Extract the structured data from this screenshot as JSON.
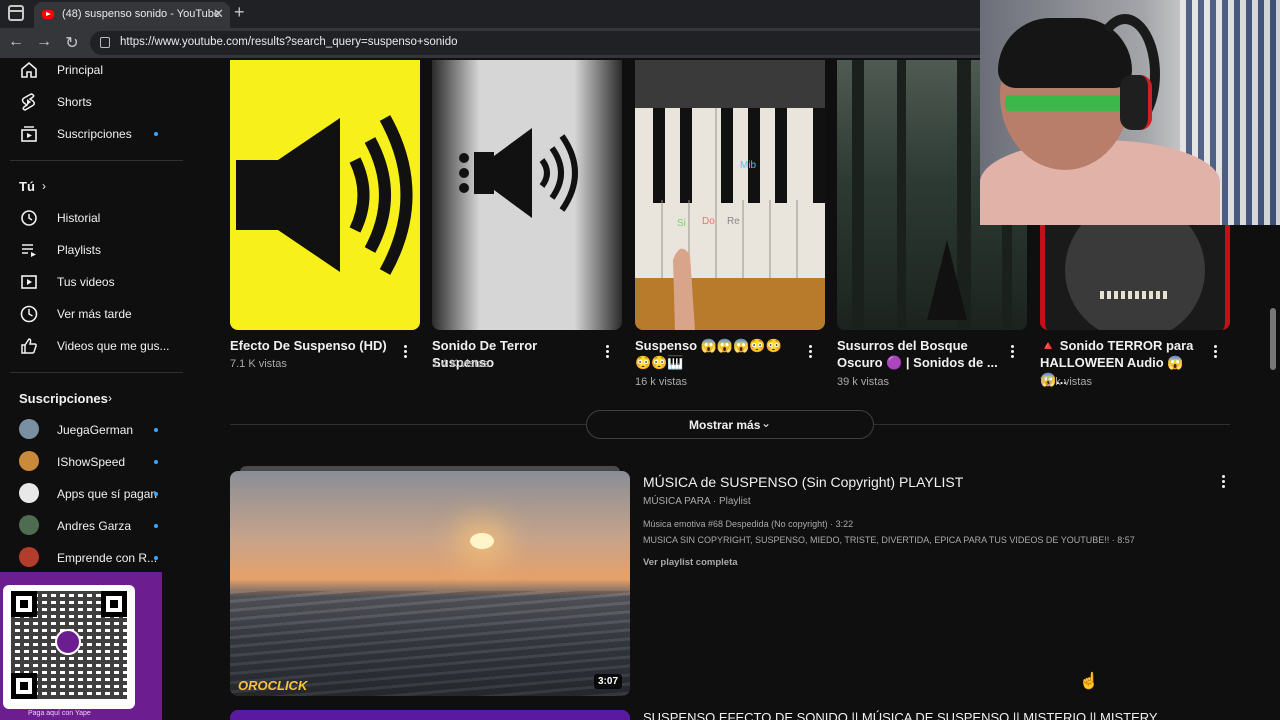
{
  "browser": {
    "tab_title": "(48) suspenso sonido - YouTube",
    "url": "https://www.youtube.com/results?search_query=suspenso+sonido"
  },
  "sidebar": {
    "items": [
      {
        "label": "Principal",
        "icon": "home-icon"
      },
      {
        "label": "Shorts",
        "icon": "shorts-icon"
      },
      {
        "label": "Suscripciones",
        "icon": "subscriptions-icon"
      }
    ],
    "you_header": "Tú",
    "you_items": [
      {
        "label": "Historial",
        "icon": "history-icon"
      },
      {
        "label": "Playlists",
        "icon": "playlists-icon"
      },
      {
        "label": "Tus videos",
        "icon": "your-videos-icon"
      },
      {
        "label": "Ver más tarde",
        "icon": "watch-later-icon"
      },
      {
        "label": "Videos que me gus...",
        "icon": "like-icon"
      }
    ],
    "subs_header": "Suscripciones",
    "channels": [
      {
        "name": "JuegaGerman",
        "color": "#7b8fa3"
      },
      {
        "name": "IShowSpeed",
        "color": "#c98a3a"
      },
      {
        "name": "Apps que sí pagan",
        "color": "#e8e8e8"
      },
      {
        "name": "Andres Garza",
        "color": "#4f6b52"
      },
      {
        "name": "Emprende con R...",
        "color": "#b33c2c"
      }
    ]
  },
  "shorts": [
    {
      "title": "Efecto De Suspenso (HD)",
      "views": "7.1 K vistas"
    },
    {
      "title": "Sonido De Terror Suspenso",
      "views": "1.4 K vistas"
    },
    {
      "title": "Suspenso 😱😱😱😳😳 😳😳🎹",
      "views": "16 k vistas"
    },
    {
      "title": "Susurros del Bosque Oscuro 🟣 | Sonidos de ...",
      "views": "39 k vistas"
    },
    {
      "title": "🔺 Sonido TERROR para HALLOWEEN Audio 😱😱...",
      "views": "75 k vistas"
    }
  ],
  "piano_labels": {
    "top": "Mib",
    "left": "Si",
    "mid": "Do",
    "right": "Re"
  },
  "show_more": "Mostrar más",
  "playlist": {
    "title": "MÚSICA de SUSPENSO (Sin Copyright) PLAYLIST",
    "meta": "MÚSICA PARA · Playlist",
    "line1": "Música emotiva #68 Despedida (No copyright) · 3:22",
    "line2": "MUSICA SIN COPYRIGHT, SUSPENSO, MIEDO, TRISTE, DIVERTIDA, EPICA PARA TUS VIDEOS DE YOUTUBE!! · 8:57",
    "view_full": "Ver playlist completa",
    "duration": "3:07",
    "thumb_logo": "OROCLICK"
  },
  "next_result_title": "SUSPENSO EFECTO DE SONIDO || MÚSICA DE SUSPENSO || MISTERIO || MISTERY",
  "qr": {
    "caption": "Paga aquí con Yape",
    "logo": "yape"
  }
}
